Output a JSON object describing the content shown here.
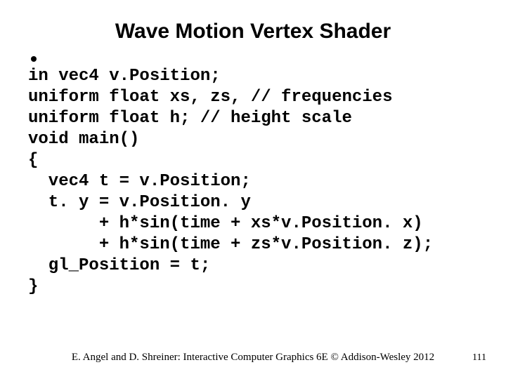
{
  "title": "Wave Motion Vertex Shader",
  "code": {
    "l1": "in vec4 v.Position;",
    "l2": "uniform float xs, zs, // frequencies",
    "l3": "uniform float h; // height scale",
    "l4": "void main()",
    "l5": "{",
    "l6": "  vec4 t = v.Position;",
    "l7": "  t. y = v.Position. y",
    "l8": "       + h*sin(time + xs*v.Position. x)",
    "l9": "       + h*sin(time + zs*v.Position. z);",
    "l10": "  gl_Position = t;",
    "l11": "}"
  },
  "footer": "E. Angel and D. Shreiner: Interactive Computer Graphics 6E © Addison-Wesley 2012",
  "page_number": "111"
}
